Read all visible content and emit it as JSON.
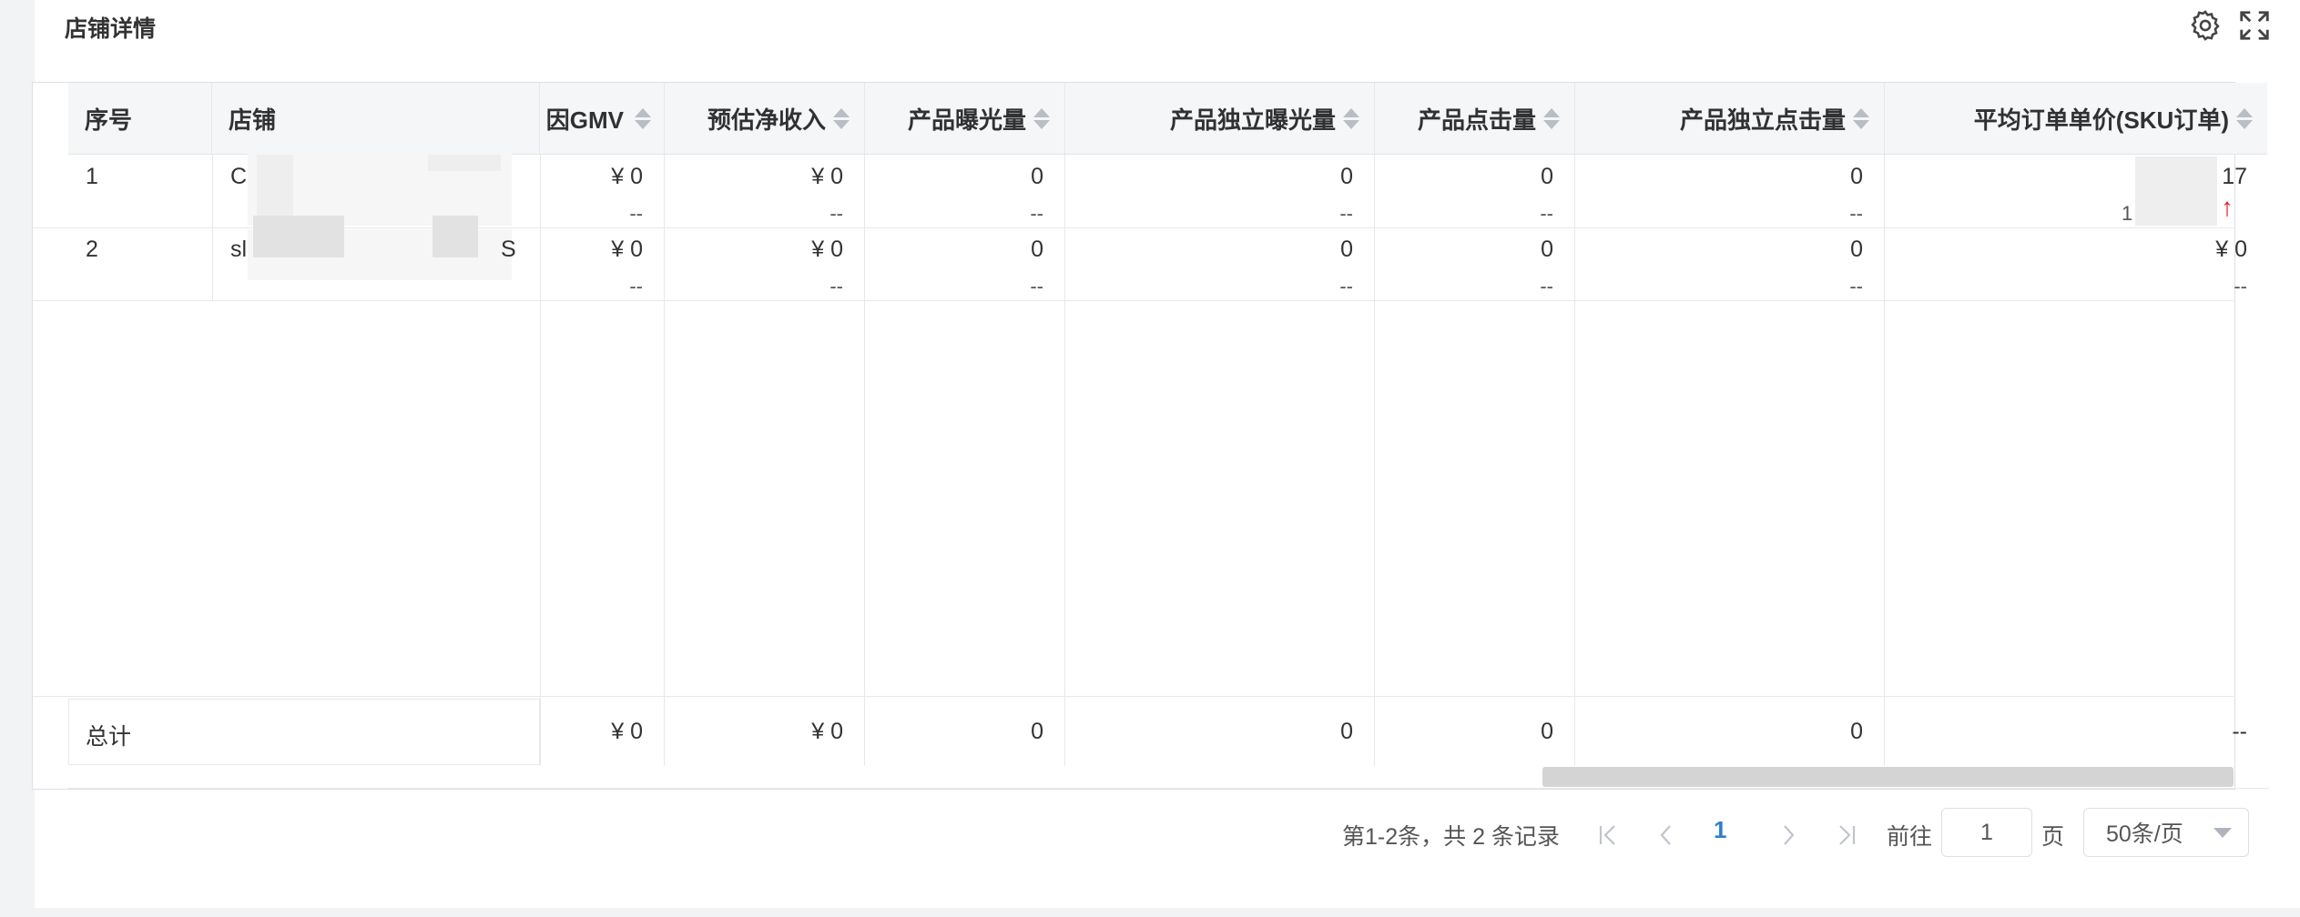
{
  "panel": {
    "title": "店铺详情",
    "icons": [
      "gear-icon",
      "fullscreen-icon"
    ]
  },
  "table": {
    "columns": [
      {
        "label": "序号",
        "sortable": false
      },
      {
        "label": "店铺",
        "sortable": false
      },
      {
        "label": "因GMV",
        "sortable": true
      },
      {
        "label": "预估净收入",
        "sortable": true
      },
      {
        "label": "产品曝光量",
        "sortable": true
      },
      {
        "label": "产品独立曝光量",
        "sortable": true
      },
      {
        "label": "产品点击量",
        "sortable": true
      },
      {
        "label": "产品独立点击量",
        "sortable": true
      },
      {
        "label": "平均订单单价(SKU订单)",
        "sortable": true
      }
    ],
    "rows": [
      {
        "index": "1",
        "shop": "C",
        "shop_suffix": "",
        "gmv": "¥ 0",
        "gmv_sub": "--",
        "net_income": "¥ 0",
        "net_income_sub": "--",
        "exposure": "0",
        "exposure_sub": "--",
        "unique_exposure": "0",
        "unique_exposure_sub": "--",
        "clicks": "0",
        "clicks_sub": "--",
        "unique_clicks": "0",
        "unique_clicks_sub": "--",
        "avg_price": "17",
        "avg_price_sub": "1"
      },
      {
        "index": "2",
        "shop": "sl",
        "shop_suffix": "S",
        "gmv": "¥ 0",
        "gmv_sub": "--",
        "net_income": "¥ 0",
        "net_income_sub": "--",
        "exposure": "0",
        "exposure_sub": "--",
        "unique_exposure": "0",
        "unique_exposure_sub": "--",
        "clicks": "0",
        "clicks_sub": "--",
        "unique_clicks": "0",
        "unique_clicks_sub": "--",
        "avg_price": "¥ 0",
        "avg_price_sub": "--"
      }
    ],
    "total": {
      "label": "总计",
      "gmv": "¥ 0",
      "net_income": "¥ 0",
      "exposure": "0",
      "unique_exposure": "0",
      "clicks": "0",
      "unique_clicks": "0",
      "avg_price": "--"
    }
  },
  "pagination": {
    "summary": "第1-2条，共 2 条记录",
    "current_page": "1",
    "goto_label": "前往",
    "goto_value": "1",
    "page_unit": "页",
    "page_size": "50条/页"
  },
  "colors": {
    "accent": "#2d7fd1",
    "trend_up": "#e02020",
    "header_bg": "#f5f6f7"
  }
}
